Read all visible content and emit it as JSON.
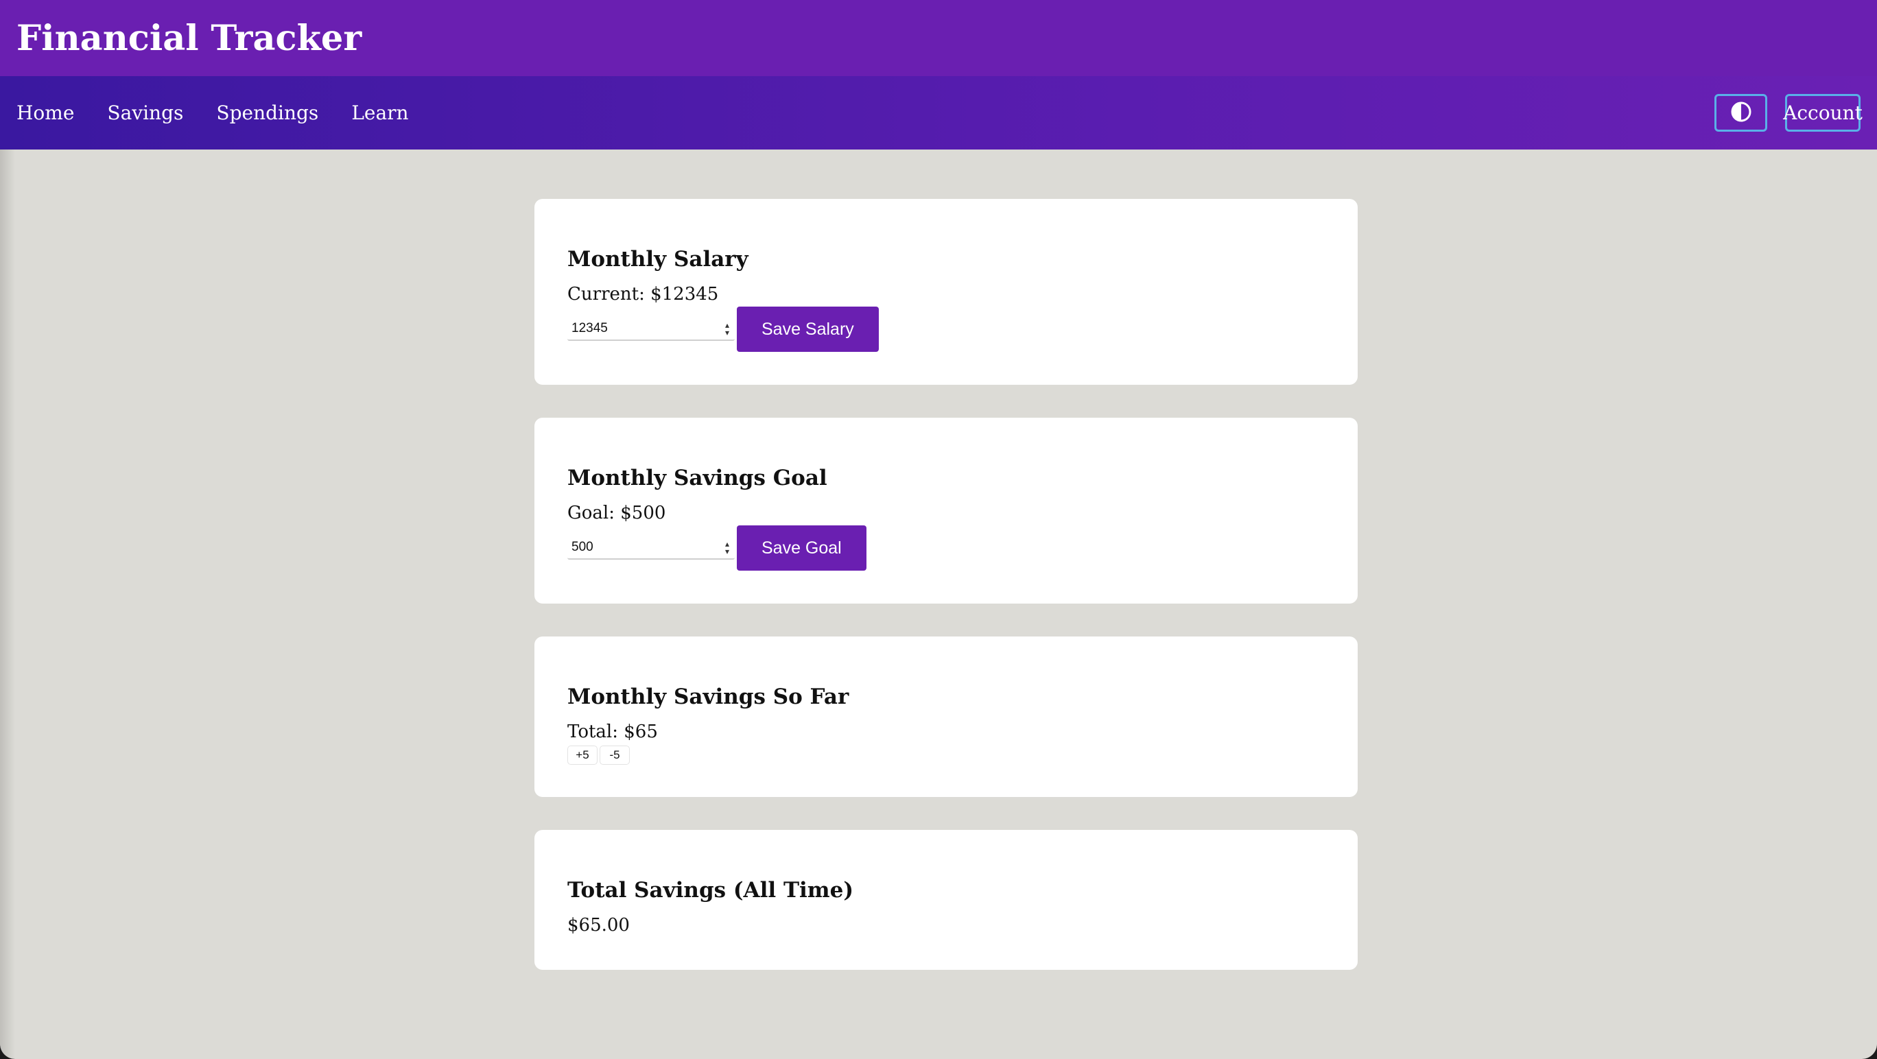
{
  "app": {
    "title": "Financial Tracker"
  },
  "nav": {
    "links": [
      "Home",
      "Savings",
      "Spendings",
      "Learn"
    ],
    "account_label": "Account"
  },
  "salary": {
    "title": "Monthly Salary",
    "current_text": "Current: $12345",
    "input_value": "12345",
    "button_label": "Save Salary"
  },
  "goal": {
    "title": "Monthly Savings Goal",
    "goal_text": "Goal: $500",
    "input_value": "500",
    "button_label": "Save Goal"
  },
  "so_far": {
    "title": "Monthly Savings So Far",
    "total_text": "Total: $65",
    "increment_label": "+5",
    "decrement_label": "-5"
  },
  "all_time": {
    "title": "Total Savings (All Time)",
    "amount": "$65.00"
  },
  "colors": {
    "header": "#6a1fb1",
    "nav_start": "#3a18a0",
    "nav_end": "#6a20b4",
    "button": "#6a1fb1",
    "outline": "#5ab0e8",
    "page_bg": "#dcdbd6"
  },
  "icons": {
    "theme_toggle": "half-circle-contrast-icon",
    "spinner": "up-down-spinner-icon"
  }
}
